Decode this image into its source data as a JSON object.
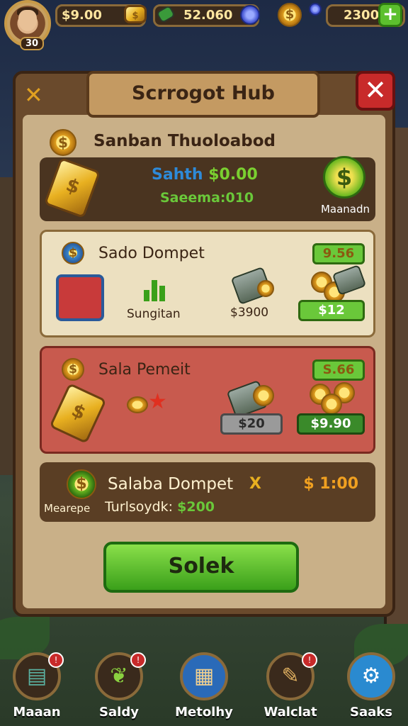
{
  "topbar": {
    "level": "30",
    "currency_1": "$9.00",
    "currency_2": "52.060",
    "currency_3": "2300",
    "plus_label": "+"
  },
  "panel": {
    "title": "Scrrogot Hub",
    "close_label": "✕",
    "left_icon": "✕",
    "section_title": "Sanban Thuoloabod",
    "balance": {
      "label": "Sahth",
      "value": "$0.00",
      "sub": "Saeema:010",
      "button_label": "Maanadn"
    },
    "wallets": [
      {
        "title": "Sado Dompet",
        "badge": "9.56",
        "item_label": "Sungitan",
        "amount": "$3900",
        "price": "$12"
      },
      {
        "title": "Sala Pemeit",
        "badge": "S.66",
        "price_grey": "$20",
        "price": "$9.90"
      }
    ],
    "summary": {
      "title": "Salaba Dompet",
      "mark": "X",
      "amount": "$ 1:00",
      "left_label": "Mearepe",
      "right_label": "Turlsoydk:",
      "right_value": "$200"
    },
    "select_label": "Solek"
  },
  "nav": [
    {
      "label": "Maaan",
      "icon": "map-icon",
      "badge": "!"
    },
    {
      "label": "Saldy",
      "icon": "plant-icon",
      "badge": "!"
    },
    {
      "label": "Metolhy",
      "icon": "calendar-grid-icon"
    },
    {
      "label": "Walclat",
      "icon": "wrench-icon",
      "badge": "!"
    },
    {
      "label": "Saaks",
      "icon": "gear-icon"
    }
  ],
  "colors": {
    "accent_green": "#5cc02e",
    "danger_red": "#c82a2a",
    "gold": "#e0a020",
    "wood": "#6a4a2c"
  }
}
